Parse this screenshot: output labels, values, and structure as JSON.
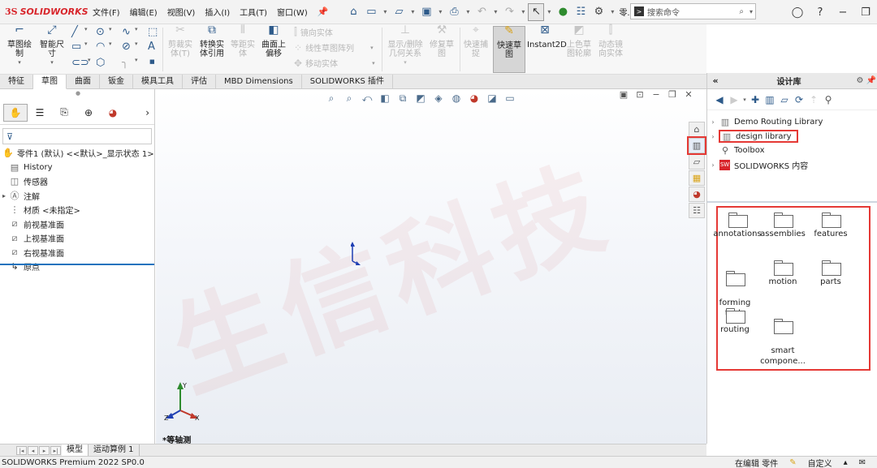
{
  "app": {
    "logo_prefix": "3S",
    "logo_name": "SOLIDWORKS"
  },
  "menu": [
    "文件(F)",
    "编辑(E)",
    "视图(V)",
    "插入(I)",
    "工具(T)",
    "窗口(W)"
  ],
  "search": {
    "placeholder": "搜索命令"
  },
  "toolbar": {
    "more_label": "零..."
  },
  "command_manager": {
    "sketch": "草图绘\n制",
    "smart_dim": "智能尺\n寸",
    "trim": "剪裁实\n体(T)",
    "convert": "转换实\n体引用",
    "offset": "等距实\n体",
    "surface_offset": "曲面上\n偏移",
    "mirror": "镜向实体",
    "linear_pattern": "线性草图阵列",
    "move": "移动实体",
    "show_delete": "显示/删除\n几何关系",
    "repair": "修复草\n图",
    "quick_snaps": "快速捕\n捉",
    "rapid_sketch": "快速草\n图",
    "instant2d": "Instant2D",
    "shaded_sketch": "上色草\n图轮廓",
    "dynamic_mirror": "动态镜\n向实体"
  },
  "tabs": [
    "特征",
    "草图",
    "曲面",
    "钣金",
    "模具工具",
    "评估",
    "MBD Dimensions",
    "SOLIDWORKS 插件"
  ],
  "active_tab": "草图",
  "feature_tree": {
    "root": "零件1 (默认) <<默认>_显示状态 1>",
    "items": [
      {
        "label": "History",
        "icon": "history-icon"
      },
      {
        "label": "传感器",
        "icon": "sensor-icon"
      },
      {
        "label": "注解",
        "icon": "annotation-icon"
      },
      {
        "label": "材质 <未指定>",
        "icon": "material-icon"
      },
      {
        "label": "前视基准面",
        "icon": "plane-icon"
      },
      {
        "label": "上视基准面",
        "icon": "plane-icon"
      },
      {
        "label": "右视基准面",
        "icon": "plane-icon"
      },
      {
        "label": "原点",
        "icon": "origin-icon"
      }
    ]
  },
  "graphics": {
    "view_label": "*等轴测",
    "watermark": "生信科技"
  },
  "design_library": {
    "title": "设计库",
    "tree": [
      {
        "label": "Demo Routing Library",
        "expandable": true
      },
      {
        "label": "design library",
        "expandable": true,
        "highlighted": true
      },
      {
        "label": "Toolbox",
        "expandable": false
      },
      {
        "label": "SOLIDWORKS 内容",
        "expandable": true
      }
    ],
    "folders": [
      "annotations",
      "assemblies",
      "features",
      "forming\ntools",
      "motion",
      "parts",
      "routing",
      "smart\ncompone..."
    ]
  },
  "model_tabs": [
    "模型",
    "运动算例 1"
  ],
  "status": {
    "version": "SOLIDWORKS Premium 2022 SP0.0",
    "editing": "在编辑 零件",
    "custom": "自定义"
  },
  "colors": {
    "brand": "#d8252b",
    "highlight": "#e53935",
    "active_blue": "#1e73be"
  }
}
